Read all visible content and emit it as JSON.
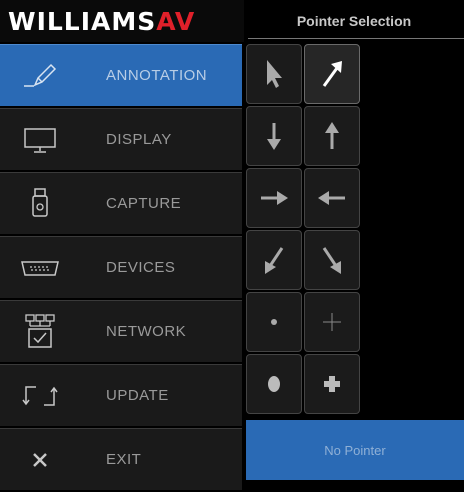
{
  "logo": {
    "main": "WILLIAMS",
    "accent": "AV"
  },
  "panel": {
    "title": "Pointer Selection",
    "no_pointer_label": "No Pointer"
  },
  "sidebar": {
    "items": [
      {
        "label": "ANNOTATION",
        "icon": "pencil-icon",
        "active": true
      },
      {
        "label": "DISPLAY",
        "icon": "monitor-icon"
      },
      {
        "label": "CAPTURE",
        "icon": "usb-drive-icon"
      },
      {
        "label": "DEVICES",
        "icon": "vga-connector-icon"
      },
      {
        "label": "NETWORK",
        "icon": "network-icon"
      },
      {
        "label": "UPDATE",
        "icon": "update-icon"
      },
      {
        "label": "EXIT",
        "icon": "close-icon"
      }
    ]
  },
  "pointers": [
    {
      "icon": "cursor-arrow-icon"
    },
    {
      "icon": "arrow-up-right-icon",
      "selected": true
    },
    {
      "icon": "arrow-down-icon"
    },
    {
      "icon": "arrow-up-icon"
    },
    {
      "icon": "arrow-right-icon"
    },
    {
      "icon": "arrow-left-icon"
    },
    {
      "icon": "arrow-down-left-icon"
    },
    {
      "icon": "arrow-down-right-icon"
    },
    {
      "icon": "small-dot-icon"
    },
    {
      "icon": "thin-crosshair-icon"
    },
    {
      "icon": "large-dot-icon"
    },
    {
      "icon": "bold-plus-icon"
    }
  ],
  "colors": {
    "accent_blue": "#2a6ab5",
    "brand_red": "#e0202a"
  }
}
